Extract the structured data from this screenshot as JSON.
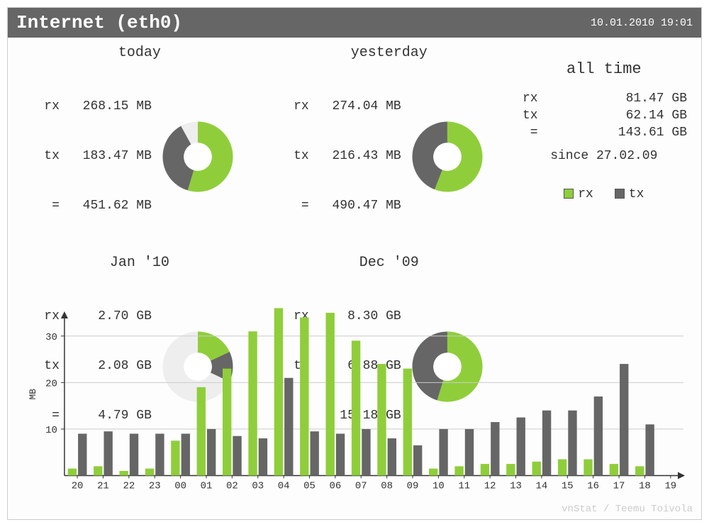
{
  "header": {
    "title": "Internet (eth0)",
    "timestamp": "10.01.2010 19:01"
  },
  "panels": {
    "today": {
      "title": "today",
      "rx": "268.15 MB",
      "tx": "183.47 MB",
      "total": "451.62 MB",
      "rx_frac": 0.594,
      "fill_frac": 0.92
    },
    "yesterday": {
      "title": "yesterday",
      "rx": "274.04 MB",
      "tx": "216.43 MB",
      "total": "490.47 MB",
      "rx_frac": 0.559,
      "fill_frac": 1.0
    },
    "jan10": {
      "title": "Jan '10",
      "rx": "2.70 GB",
      "tx": "2.08 GB",
      "total": "4.79 GB",
      "rx_frac": 0.564,
      "fill_frac": 0.32
    },
    "dec09": {
      "title": "Dec '09",
      "rx": "8.30 GB",
      "tx": "6.88 GB",
      "total": "15.18 GB",
      "rx_frac": 0.547,
      "fill_frac": 1.0
    }
  },
  "alltime": {
    "title": "all time",
    "rx": "81.47 GB",
    "tx": "62.14 GB",
    "total": "143.61 GB",
    "since": "since 27.02.09"
  },
  "legend": {
    "rx": "rx",
    "tx": "tx"
  },
  "labels": {
    "rx": "rx",
    "tx": "tx",
    "eq": " ="
  },
  "chart_data": {
    "type": "bar",
    "title": "",
    "xlabel": "",
    "ylabel": "MB",
    "ylim": [
      0,
      35
    ],
    "yticks": [
      10,
      20,
      30
    ],
    "categories": [
      "20",
      "21",
      "22",
      "23",
      "00",
      "01",
      "02",
      "03",
      "04",
      "05",
      "06",
      "07",
      "08",
      "09",
      "10",
      "11",
      "12",
      "13",
      "14",
      "15",
      "16",
      "17",
      "18",
      "19"
    ],
    "series": [
      {
        "name": "rx",
        "color": "#8fce3a",
        "values": [
          1.5,
          2,
          1,
          1.5,
          7.5,
          19,
          23,
          31,
          36,
          34,
          35,
          29,
          24,
          23,
          1.5,
          2,
          2.5,
          2.5,
          3,
          3.5,
          3.5,
          2.5,
          2,
          0
        ]
      },
      {
        "name": "tx",
        "color": "#666666",
        "values": [
          9,
          9.5,
          9,
          9,
          9,
          10,
          8.5,
          8,
          21,
          9.5,
          9,
          10,
          8,
          6.5,
          10,
          10,
          11.5,
          12.5,
          14,
          14,
          17,
          24,
          11,
          0
        ]
      }
    ]
  },
  "footer": "vnStat / Teemu Toivola"
}
